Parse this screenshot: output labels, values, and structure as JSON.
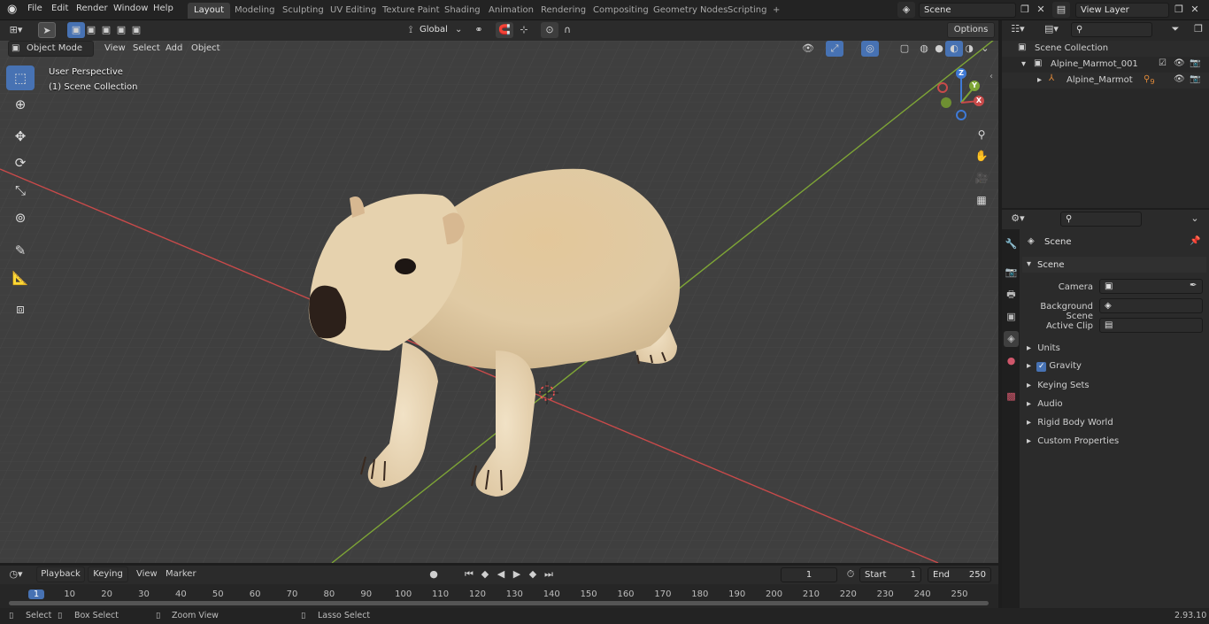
{
  "app": {
    "version": "2.93.10"
  },
  "topbar": {
    "menus": [
      "File",
      "Edit",
      "Render",
      "Window",
      "Help"
    ],
    "workspaces": [
      "Layout",
      "Modeling",
      "Sculpting",
      "UV Editing",
      "Texture Paint",
      "Shading",
      "Animation",
      "Rendering",
      "Compositing",
      "Geometry Nodes",
      "Scripting"
    ],
    "active_workspace": "Layout",
    "add_tab_label": "+",
    "scene_name": "Scene",
    "view_layer": "View Layer"
  },
  "viewport_header": {
    "transform_orientation": "Global",
    "mode": "Object Mode",
    "menus": [
      "View",
      "Select",
      "Add",
      "Object"
    ],
    "options_label": "Options"
  },
  "viewport": {
    "perspective_label": "User Perspective",
    "collection_label": "(1) Scene Collection",
    "gizmo_axes": {
      "z": "Z",
      "y": "Y",
      "x": "X"
    },
    "colors": {
      "x_axis": "#c84a4a",
      "y_axis": "#7ea536",
      "z_axis": "#3f7ad6",
      "active_tool": "#4772b3"
    }
  },
  "outliner": {
    "root": "Scene Collection",
    "items": [
      {
        "label": "Alpine_Marmot_001",
        "type": "collection"
      },
      {
        "label": "Alpine_Marmot",
        "type": "armature",
        "badge": "9"
      }
    ]
  },
  "properties": {
    "header_title": "Scene",
    "section": "Scene",
    "fields": [
      {
        "label": "Camera",
        "value": ""
      },
      {
        "label": "Background Scene",
        "value": ""
      },
      {
        "label": "Active Clip",
        "value": ""
      }
    ],
    "subpanels": [
      "Units",
      "Gravity",
      "Keying Sets",
      "Audio",
      "Rigid Body World",
      "Custom Properties"
    ],
    "gravity_checked": true
  },
  "timeline": {
    "menus": [
      "Playback",
      "Keying",
      "View",
      "Marker"
    ],
    "current_frame": "1",
    "start_label": "Start",
    "start": "1",
    "end_label": "End",
    "end": "250",
    "ticks": [
      "1",
      "10",
      "20",
      "30",
      "40",
      "50",
      "60",
      "70",
      "80",
      "90",
      "100",
      "110",
      "120",
      "130",
      "140",
      "150",
      "160",
      "170",
      "180",
      "190",
      "200",
      "210",
      "220",
      "230",
      "240",
      "250"
    ]
  },
  "statusbar": {
    "items": [
      "Select",
      "Box Select",
      "Zoom View",
      "Lasso Select"
    ]
  }
}
